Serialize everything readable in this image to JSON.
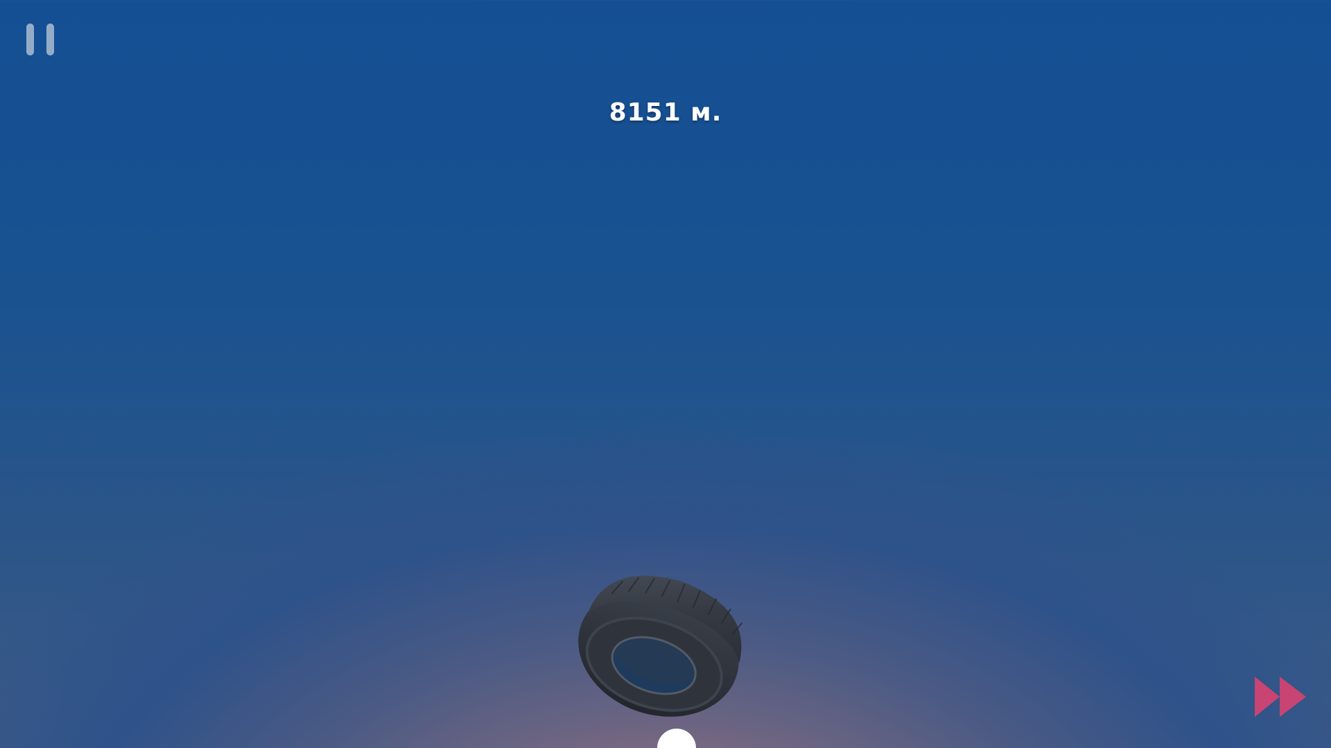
{
  "hud": {
    "distance_label": "8151 м.",
    "pause_icon": "pause-icon",
    "skip_icon": "fast-forward-icon"
  },
  "scene": {
    "player_object": "tire",
    "ball": "ball"
  },
  "colors": {
    "sky_top": "#144f94",
    "sky_horizon": "#a87a84",
    "skip_button": "#e03a6a",
    "pause_button": "#c8d0de"
  }
}
